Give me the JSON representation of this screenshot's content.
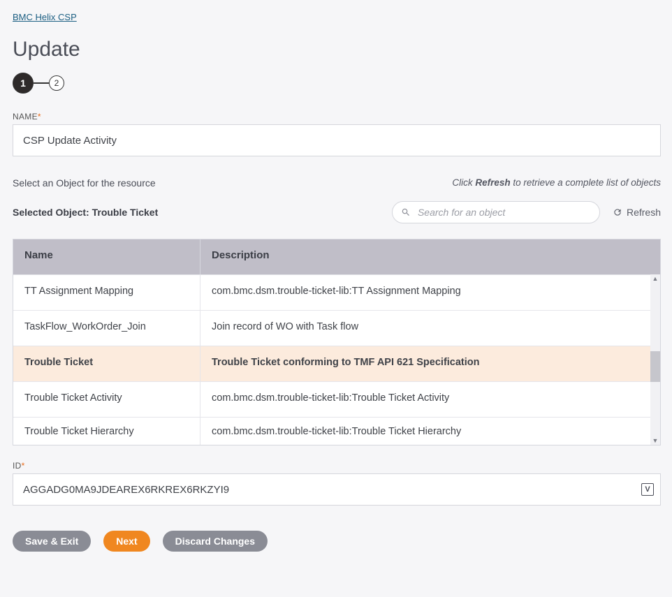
{
  "breadcrumb": "BMC Helix CSP",
  "pageTitle": "Update",
  "stepper": {
    "current": "1",
    "next": "2"
  },
  "nameField": {
    "label": "NAME",
    "value": "CSP Update Activity"
  },
  "objectSection": {
    "hintLeft": "Select an Object for the resource",
    "hintRightPrefix": "Click ",
    "hintRightBold": "Refresh",
    "hintRightSuffix": " to retrieve a complete list of objects",
    "selectedPrefix": "Selected Object: ",
    "selectedObject": "Trouble Ticket",
    "searchPlaceholder": "Search for an object",
    "refreshLabel": "Refresh"
  },
  "table": {
    "headers": {
      "name": "Name",
      "description": "Description"
    },
    "rows": [
      {
        "name": "TT Assignment Mapping",
        "description": "com.bmc.dsm.trouble-ticket-lib:TT Assignment Mapping",
        "selected": false
      },
      {
        "name": "TaskFlow_WorkOrder_Join",
        "description": "Join record of WO with Task flow",
        "selected": false
      },
      {
        "name": "Trouble Ticket",
        "description": "Trouble Ticket conforming to TMF API 621 Specification",
        "selected": true
      },
      {
        "name": "Trouble Ticket Activity",
        "description": "com.bmc.dsm.trouble-ticket-lib:Trouble Ticket Activity",
        "selected": false
      },
      {
        "name": "Trouble Ticket Hierarchy",
        "description": "com.bmc.dsm.trouble-ticket-lib:Trouble Ticket Hierarchy",
        "selected": false
      }
    ]
  },
  "idField": {
    "label": "ID",
    "value": "AGGADG0MA9JDEAREX6RKREX6RKZYI9"
  },
  "buttons": {
    "saveExit": "Save & Exit",
    "next": "Next",
    "discard": "Discard Changes"
  }
}
